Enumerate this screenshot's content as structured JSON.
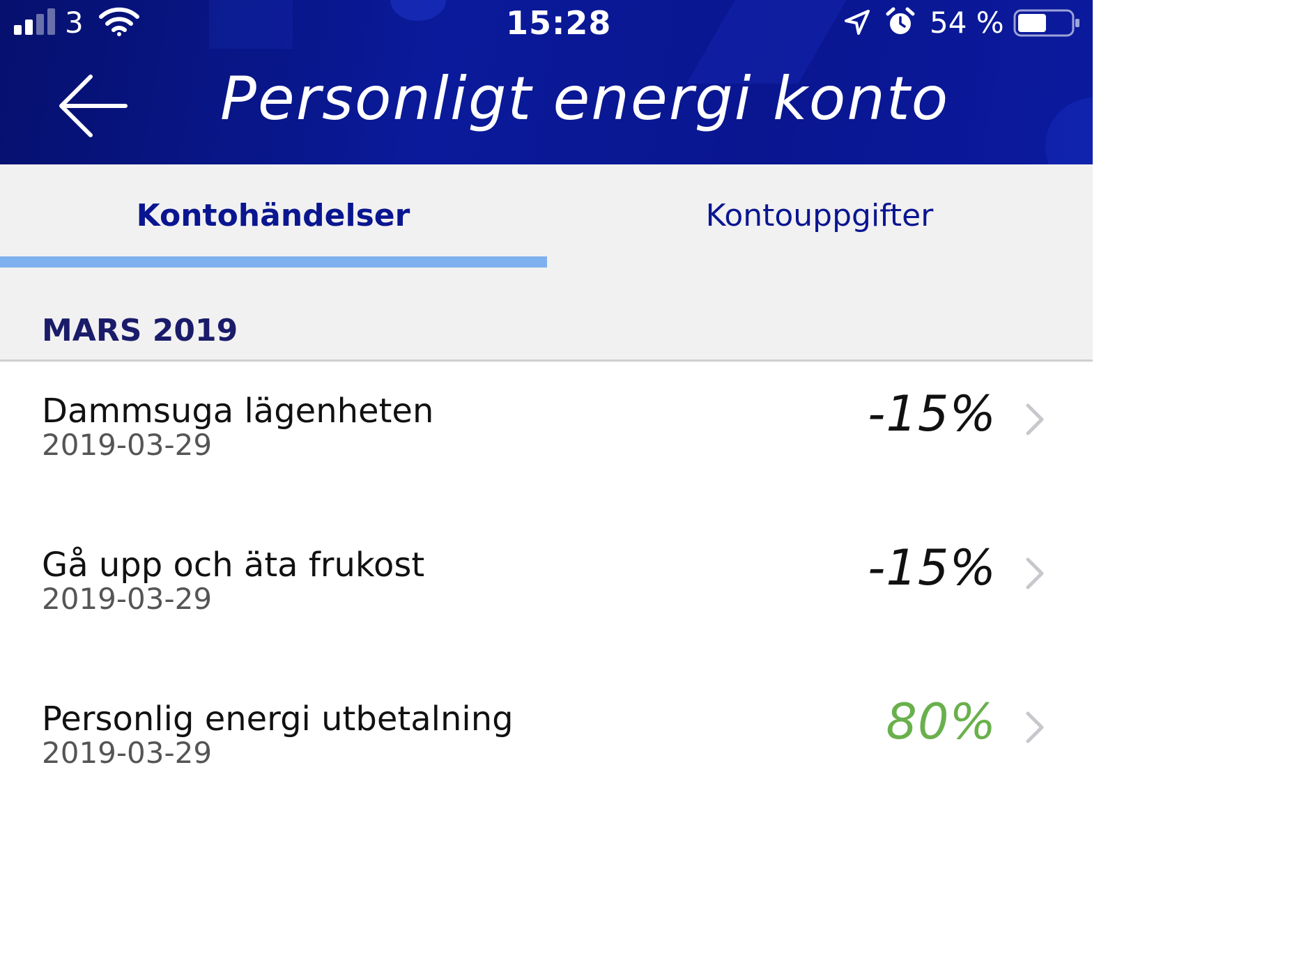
{
  "status_bar": {
    "carrier": "3",
    "time": "15:28",
    "battery_percent": "54 %",
    "battery_level": 0.54,
    "signal_bars_filled": 2,
    "signal_bars_total": 4,
    "icons": [
      "signal-icon",
      "wifi-icon",
      "location-arrow-icon",
      "alarm-icon",
      "battery-icon"
    ]
  },
  "header": {
    "title": "Personligt energi konto",
    "back_icon": "back-arrow-icon",
    "background_color": "#0a1690"
  },
  "tabs": [
    {
      "label": "Kontohändelser",
      "active": true
    },
    {
      "label": "Kontouppgifter",
      "active": false
    }
  ],
  "colors": {
    "accent": "#0a1690",
    "tab_indicator": "#7fb0ee",
    "negative_amount": "#111111",
    "positive_amount": "#6ab04c"
  },
  "section": {
    "title": "MARS 2019"
  },
  "transactions": [
    {
      "title": "Dammsuga lägenheten",
      "date": "2019-03-29",
      "amount": "-15%",
      "kind": "negative"
    },
    {
      "title": "Gå upp och äta frukost",
      "date": "2019-03-29",
      "amount": "-15%",
      "kind": "negative"
    },
    {
      "title": "Personlig energi utbetalning",
      "date": "2019-03-29",
      "amount": "80%",
      "kind": "positive"
    }
  ]
}
